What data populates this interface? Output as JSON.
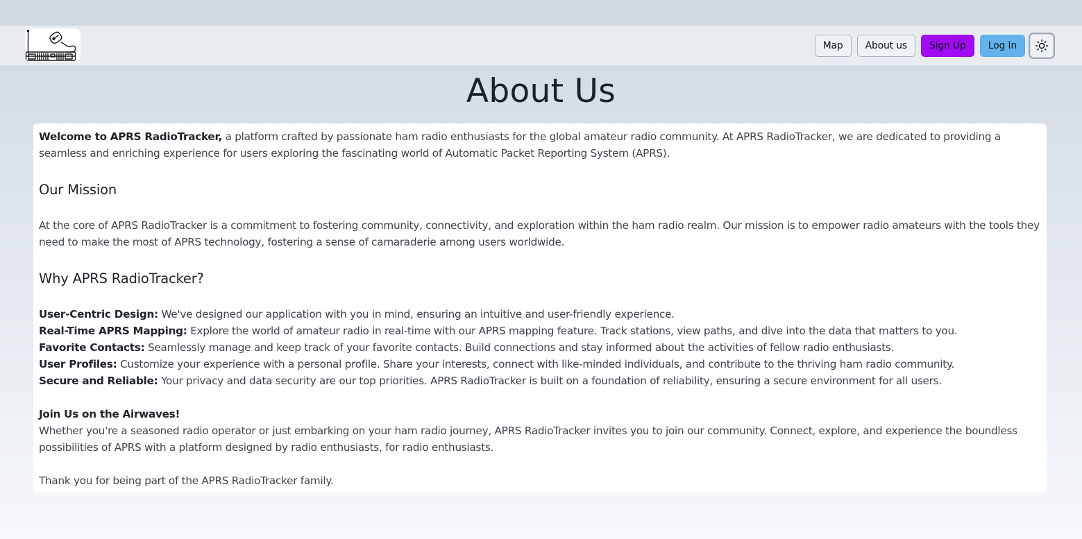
{
  "nav": {
    "map_label": "Map",
    "about_label": "About us",
    "signup_label": "Sign Up",
    "login_label": "Log In"
  },
  "page": {
    "title": "About Us"
  },
  "content": {
    "intro_bold": "Welcome to APRS RadioTracker,",
    "intro_text": " a platform crafted by passionate ham radio enthusiasts for the global amateur radio community. At APRS RadioTracker, we are dedicated to providing a seamless and enriching experience for users exploring the fascinating world of Automatic Packet Reporting System (APRS).",
    "mission_heading": "Our Mission",
    "mission_text": "At the core of APRS RadioTracker is a commitment to fostering community, connectivity, and exploration within the ham radio realm. Our mission is to empower radio amateurs with the tools they need to make the most of APRS technology, fostering a sense of camaraderie among users worldwide.",
    "why_heading": "Why APRS RadioTracker?",
    "features": [
      {
        "title": "User-Centric Design:",
        "text": " We've designed our application with you in mind, ensuring an intuitive and user-friendly experience."
      },
      {
        "title": "Real-Time APRS Mapping:",
        "text": " Explore the world of amateur radio in real-time with our APRS mapping feature. Track stations, view paths, and dive into the data that matters to you."
      },
      {
        "title": "Favorite Contacts:",
        "text": " Seamlessly manage and keep track of your favorite contacts. Build connections and stay informed about the activities of fellow radio enthusiasts."
      },
      {
        "title": "User Profiles:",
        "text": " Customize your experience with a personal profile. Share your interests, connect with like-minded individuals, and contribute to the thriving ham radio community."
      },
      {
        "title": "Secure and Reliable:",
        "text": " Your privacy and data security are our top priorities. APRS RadioTracker is built on a foundation of reliability, ensuring a secure environment for all users."
      }
    ],
    "join_heading": "Join Us on the Airwaves!",
    "join_text": "Whether you're a seasoned radio operator or just embarking on your ham radio journey, APRS RadioTracker invites you to join our community. Connect, explore, and experience the boundless possibilities of APRS with a platform designed by radio enthusiasts, for radio enthusiasts.",
    "thanks_text": "Thank you for being part of the APRS RadioTracker family."
  },
  "icons": {
    "logo": "radio-transceiver-logo",
    "theme_toggle": "sun-icon"
  },
  "colors": {
    "signup_bg": "#a20bf5",
    "login_bg": "#63b2ec",
    "navbar_bg": "#e8ecf1"
  }
}
